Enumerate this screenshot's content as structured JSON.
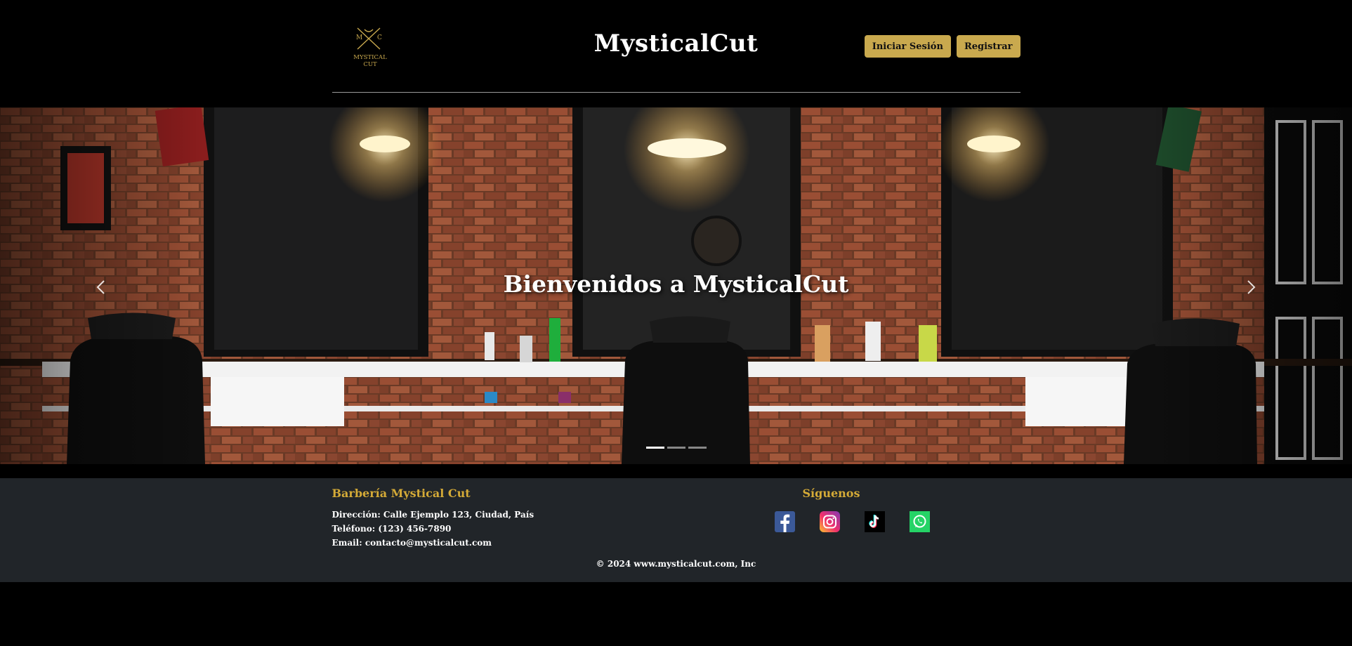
{
  "header": {
    "logo_initials": "M C",
    "logo_text_line1": "MYSTICAL",
    "logo_text_line2": "CUT",
    "title": "MysticalCut",
    "login_label": "Iniciar Sesión",
    "register_label": "Registrar"
  },
  "hero": {
    "caption": "Bienvenidos a MysticalCut",
    "prev_icon": "chevron-left-icon",
    "next_icon": "chevron-right-icon",
    "slides": 3,
    "active_slide": 0
  },
  "footer": {
    "brand": "Barbería Mystical Cut",
    "address": "Dirección: Calle Ejemplo 123, Ciudad, País",
    "phone": "Teléfono: (123) 456-7890",
    "email": "Email: contacto@mysticalcut.com",
    "follow_title": "Síguenos",
    "socials": [
      "facebook-icon",
      "instagram-icon",
      "tiktok-icon",
      "whatsapp-icon"
    ],
    "copyright": "© 2024 www.mysticalcut.com, Inc"
  },
  "colors": {
    "accent": "#c9a94e",
    "footer_heading": "#d4aa37",
    "footer_bg": "#212529",
    "page_bg": "#000000"
  }
}
